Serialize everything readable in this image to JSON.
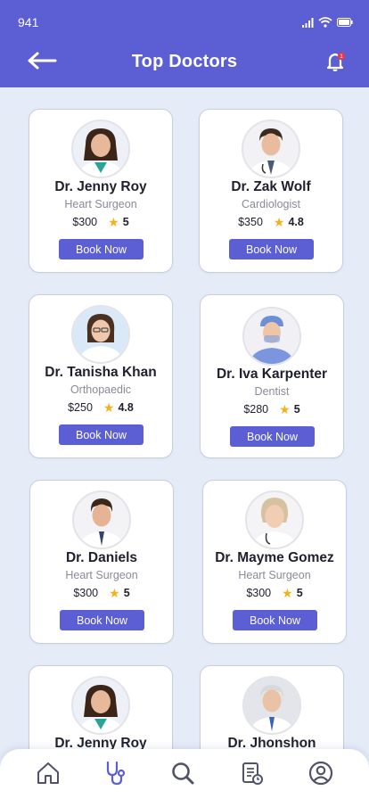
{
  "status_bar": {
    "time": "941"
  },
  "header": {
    "title": "Top Doctors",
    "notification_count": "1"
  },
  "doctors": [
    {
      "name": "Dr. Jenny Roy",
      "specialty": "Heart Surgeon",
      "price": "$300",
      "rating": "5",
      "button": "Book Now"
    },
    {
      "name": "Dr. Zak Wolf",
      "specialty": "Cardiologist",
      "price": "$350",
      "rating": "4.8",
      "button": "Book Now"
    },
    {
      "name": "Dr. Tanisha Khan",
      "specialty": "Orthopaedic",
      "price": "$250",
      "rating": "4.8",
      "button": "Book Now"
    },
    {
      "name": "Dr. Iva Karpenter",
      "specialty": "Dentist",
      "price": "$280",
      "rating": "5",
      "button": "Book Now"
    },
    {
      "name": "Dr. Daniels",
      "specialty": "Heart Surgeon",
      "price": "$300",
      "rating": "5",
      "button": "Book Now"
    },
    {
      "name": "Dr. Mayme Gomez",
      "specialty": "Heart Surgeon",
      "price": "$300",
      "rating": "5",
      "button": "Book Now"
    },
    {
      "name": "Dr. Jenny Roy",
      "specialty": "",
      "price": "",
      "rating": "",
      "button": ""
    },
    {
      "name": "Dr. Jhonshon",
      "specialty": "",
      "price": "",
      "rating": "",
      "button": ""
    }
  ],
  "bottom_nav": [
    {
      "icon": "home-icon"
    },
    {
      "icon": "stethoscope-icon"
    },
    {
      "icon": "search-icon"
    },
    {
      "icon": "records-icon"
    },
    {
      "icon": "profile-icon"
    }
  ],
  "colors": {
    "primary": "#5b5fd3",
    "background": "#e6ebf8",
    "star": "#f3b11b",
    "nav_icon": "#52526a"
  }
}
